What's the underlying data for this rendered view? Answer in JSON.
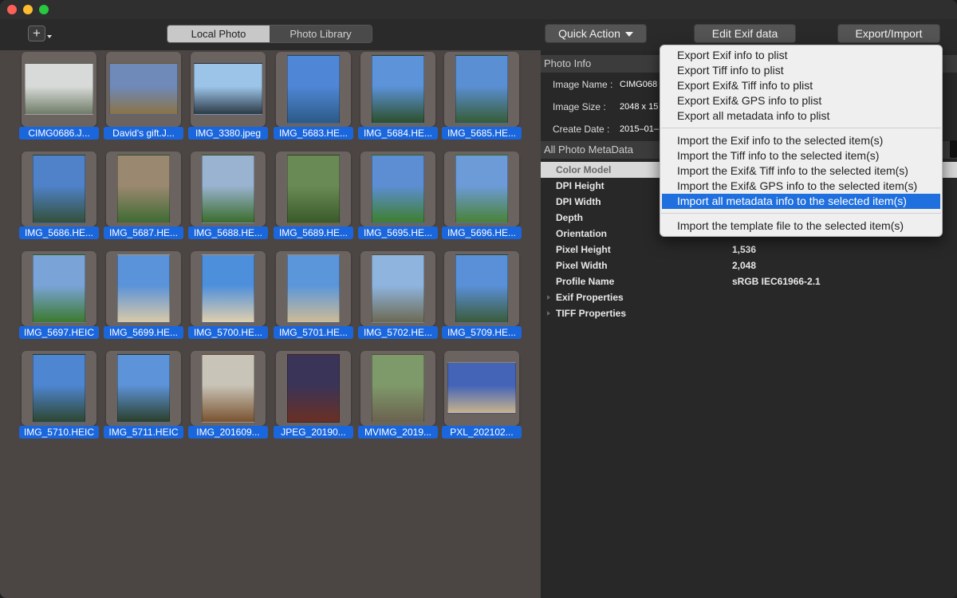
{
  "toolbar": {
    "segments": [
      "Local Photo",
      "Photo Library"
    ],
    "quick_action": "Quick Action",
    "edit_exif": "Edit Exif data",
    "export_import": "Export/Import"
  },
  "photos": [
    {
      "label": "CIMG0686.J...",
      "c1": "#d7dad8",
      "c2": "#6f7c68"
    },
    {
      "label": "David's gift.J...",
      "c1": "#6f89b8",
      "c2": "#8a7447"
    },
    {
      "label": "IMG_3380.jpeg",
      "c1": "#9cc4e8",
      "c2": "#2d3a47"
    },
    {
      "label": "IMG_5683.HE...",
      "c1": "#4f87d6",
      "c2": "#2c5a86"
    },
    {
      "label": "IMG_5684.HE...",
      "c1": "#5c93d9",
      "c2": "#2d4f2a"
    },
    {
      "label": "IMG_5685.HE...",
      "c1": "#5b8fd3",
      "c2": "#365c35"
    },
    {
      "label": "IMG_5686.HE...",
      "c1": "#4f82c9",
      "c2": "#34503a"
    },
    {
      "label": "IMG_5687.HE...",
      "c1": "#9b8870",
      "c2": "#3f6b33"
    },
    {
      "label": "IMG_5688.HE...",
      "c1": "#9ab3d1",
      "c2": "#3a6d2b"
    },
    {
      "label": "IMG_5689.HE...",
      "c1": "#6a8a55",
      "c2": "#3a5a2a"
    },
    {
      "label": "IMG_5695.HE...",
      "c1": "#5d8ed4",
      "c2": "#3e7f2e"
    },
    {
      "label": "IMG_5696.HE...",
      "c1": "#6d9bd8",
      "c2": "#4a8236"
    },
    {
      "label": "IMG_5697.HEIC",
      "c1": "#7aa4d8",
      "c2": "#3c7a2f"
    },
    {
      "label": "IMG_5699.HE...",
      "c1": "#5a93d9",
      "c2": "#d9c9a8"
    },
    {
      "label": "IMG_5700.HE...",
      "c1": "#4e8fdc",
      "c2": "#e0cfae"
    },
    {
      "label": "IMG_5701.HE...",
      "c1": "#5b96da",
      "c2": "#cdbb97"
    },
    {
      "label": "IMG_5702.HE...",
      "c1": "#8fb5df",
      "c2": "#6c6a53"
    },
    {
      "label": "IMG_5709.HE...",
      "c1": "#5a90d8",
      "c2": "#3b5b3a"
    },
    {
      "label": "IMG_5710.HEIC",
      "c1": "#4e86d2",
      "c2": "#2d4630"
    },
    {
      "label": "IMG_5711.HEIC",
      "c1": "#5d93d8",
      "c2": "#2b3f2a"
    },
    {
      "label": "IMG_201609...",
      "c1": "#c9c4b8",
      "c2": "#7a5330"
    },
    {
      "label": "JPEG_20190...",
      "c1": "#3a3458",
      "c2": "#6a3024"
    },
    {
      "label": "MVIMG_2019...",
      "c1": "#7f9a6a",
      "c2": "#6b6250"
    },
    {
      "label": "PXL_202102...",
      "c1": "#4464b8",
      "c2": "#c9b48c"
    }
  ],
  "photo_info": {
    "header": "Photo Info",
    "rows": [
      {
        "label": "Image Name :",
        "value": "CIMG068"
      },
      {
        "label": "Image Size :",
        "value": "2048 x 15"
      },
      {
        "label": "Create Date :",
        "value": "2015–01–"
      }
    ]
  },
  "metadata": {
    "header": "All Photo MetaData",
    "rows": [
      {
        "key": "Color Model",
        "value": "",
        "selected": true,
        "expandable": false
      },
      {
        "key": "DPI Height",
        "value": "",
        "selected": false,
        "expandable": false
      },
      {
        "key": "DPI Width",
        "value": "",
        "selected": false,
        "expandable": false
      },
      {
        "key": "Depth",
        "value": "",
        "selected": false,
        "expandable": false
      },
      {
        "key": "Orientation",
        "value": "",
        "selected": false,
        "expandable": false
      },
      {
        "key": "Pixel Height",
        "value": "1,536",
        "selected": false,
        "expandable": false
      },
      {
        "key": "Pixel Width",
        "value": "2,048",
        "selected": false,
        "expandable": false
      },
      {
        "key": "Profile Name",
        "value": "sRGB IEC61966-2.1",
        "selected": false,
        "expandable": false
      },
      {
        "key": "Exif Properties",
        "value": "",
        "selected": false,
        "expandable": true
      },
      {
        "key": "TIFF Properties",
        "value": "",
        "selected": false,
        "expandable": true
      }
    ]
  },
  "menu": {
    "groups": [
      [
        "Export Exif info to plist",
        "Export Tiff info to plist",
        "Export Exif& Tiff info to plist",
        "Export Exif& GPS info to plist",
        "Export all metadata info to plist"
      ],
      [
        "Import the Exif info to the selected item(s)",
        "Import the Tiff info to the selected item(s)",
        "Import the Exif& Tiff info to the selected item(s)",
        "Import the Exif& GPS info to the selected item(s)",
        "Import all metadata info to the selected item(s)"
      ],
      [
        "Import the template file to the selected item(s)"
      ]
    ],
    "highlighted": "Import all metadata info to the selected item(s)"
  }
}
